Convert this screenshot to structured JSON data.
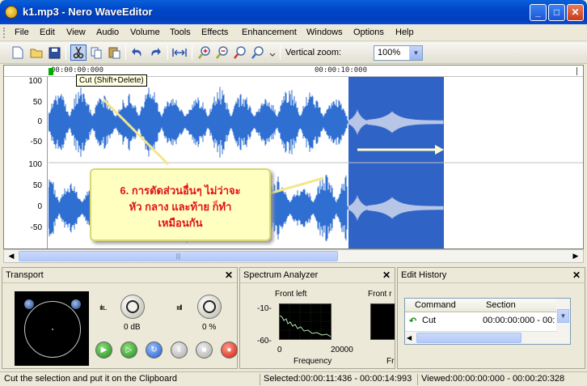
{
  "window": {
    "title": "k1.mp3 - Nero WaveEditor",
    "minimize": "_",
    "maximize": "□",
    "close": "✕"
  },
  "menu": [
    "File",
    "Edit",
    "View",
    "Audio",
    "Volume",
    "Tools",
    "Effects",
    "Enhancement",
    "Windows",
    "Options",
    "Help"
  ],
  "toolbar": {
    "icons": [
      "new-file-icon",
      "open-folder-icon",
      "save-icon",
      "cut-icon",
      "copy-icon",
      "paste-icon",
      "undo-icon",
      "redo-icon",
      "select-all-icon",
      "zoom-in-icon",
      "zoom-out-icon",
      "zoom-selection-icon",
      "zoom-fit-icon"
    ],
    "vertical_zoom_label": "Vertical zoom:",
    "vertical_zoom_value": "100%",
    "tooltip": "Cut (Shift+Delete)"
  },
  "ruler": {
    "start": "00:00:00:000",
    "mid": "00:00:10:000"
  },
  "yaxis": {
    "top_channel": [
      "100",
      "50",
      "0",
      "-50"
    ],
    "bottom_channel": [
      "100",
      "50",
      "0",
      "-50"
    ]
  },
  "annotation": {
    "line1": "6. การตัดส่วนอื่นๆ ไม่ว่าจะ",
    "line2": "หัว กลาง และท้าย ก็ทำ",
    "line3": "เหมือนกัน"
  },
  "panels": {
    "transport": {
      "title": "Transport",
      "volume": "0 dB",
      "balance": "0 %"
    },
    "spectrum": {
      "title": "Spectrum Analyzer",
      "channel_left": "Front left",
      "channel_right": "Front r",
      "y_top": "-10-",
      "y_bottom": "-60-",
      "x_start": "0",
      "x_end": "20000",
      "x_label": "Frequency",
      "x_label_right": "Fr"
    },
    "history": {
      "title": "Edit History",
      "col_command": "Command",
      "col_section": "Section",
      "row_command": "Cut",
      "row_section": "00:00:00:000 - 00:"
    }
  },
  "status": {
    "message": "Cut the selection and put it on the Clipboard",
    "selected": "Selected:00:00:11:436 - 00:00:14:993",
    "viewed": "Viewed:00:00:00:000 - 00:00:20:328"
  },
  "colors": {
    "waveform": "#2f6fd1",
    "selection": "#2f63c6",
    "annotation_text": "#e0121a",
    "callout_bg": "#ffffc0"
  }
}
